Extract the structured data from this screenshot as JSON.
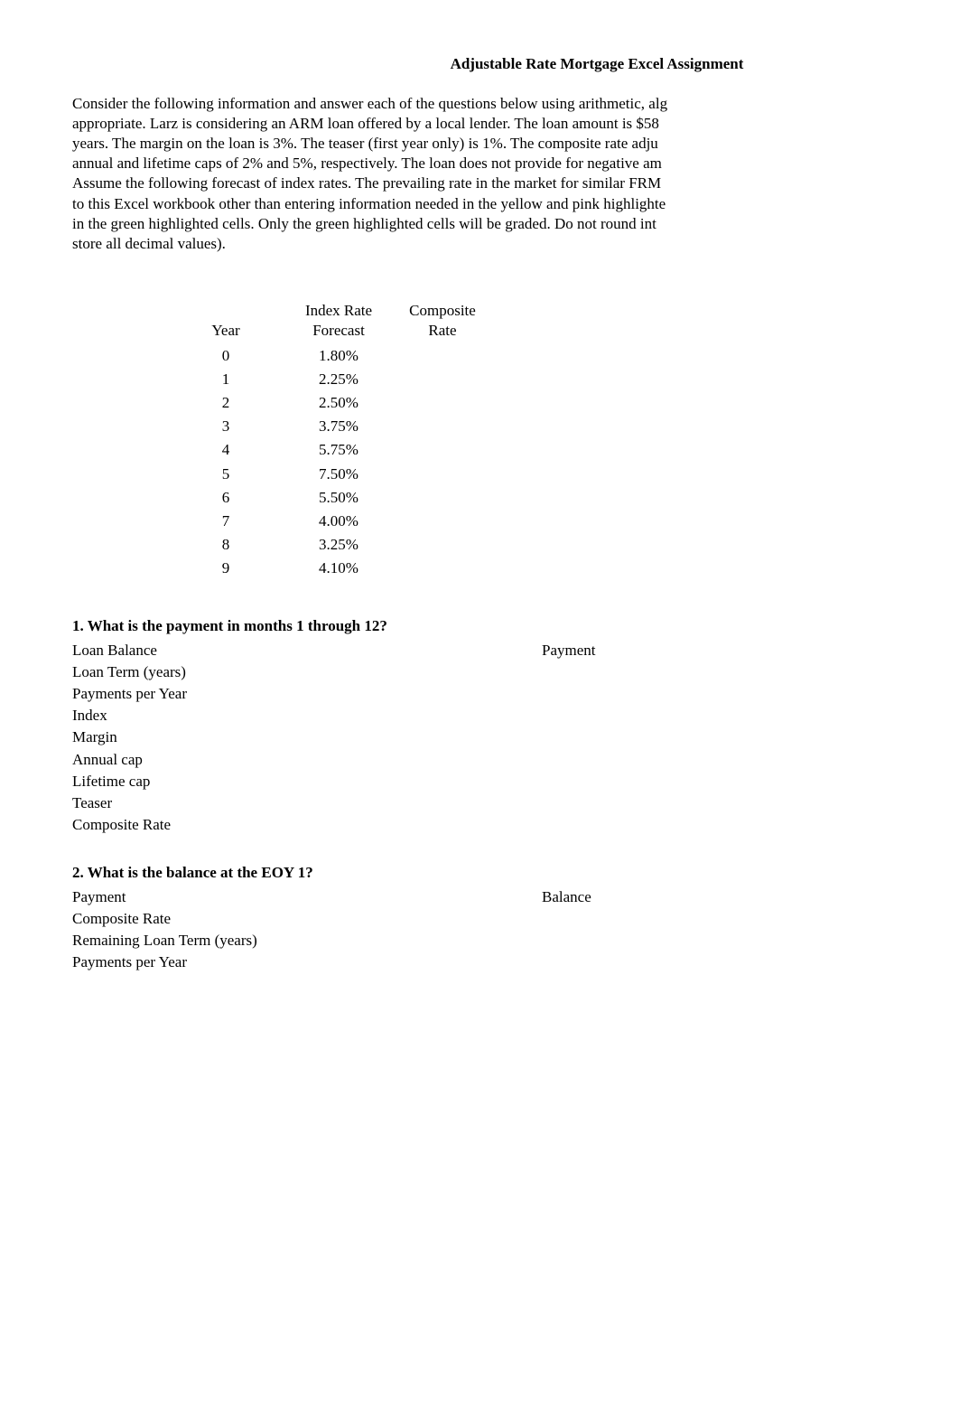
{
  "title": "Adjustable Rate Mortgage Excel Assignment",
  "intro_lines": [
    "Consider the following information and answer each of the questions below using arithmetic, alg",
    "appropriate.  Larz is considering an ARM loan offered by a local lender.  The loan amount is $58",
    "years.  The margin on the loan is 3%.  The teaser (first year only) is 1%.  The composite rate adju",
    "annual and lifetime caps of 2% and 5%, respectively.  The loan does not provide for negative am",
    " Assume the following forecast of index rates.  The prevailing rate in the market for similar FRM",
    "to this Excel workbook other than entering information needed in the yellow and pink highlighte",
    "in the green highlighted cells.  Only the green highlighted cells will be graded.  Do not round int",
    "store all decimal values)."
  ],
  "index_table": {
    "headers": {
      "year": "Year",
      "forecast_l1": "Index Rate",
      "forecast_l2": "Forecast",
      "composite_l1": "Composite",
      "composite_l2": "Rate"
    },
    "rows": [
      {
        "year": "0",
        "forecast": "1.80%",
        "composite": ""
      },
      {
        "year": "1",
        "forecast": "2.25%",
        "composite": ""
      },
      {
        "year": "2",
        "forecast": "2.50%",
        "composite": ""
      },
      {
        "year": "3",
        "forecast": "3.75%",
        "composite": ""
      },
      {
        "year": "4",
        "forecast": "5.75%",
        "composite": ""
      },
      {
        "year": "5",
        "forecast": "7.50%",
        "composite": ""
      },
      {
        "year": "6",
        "forecast": "5.50%",
        "composite": ""
      },
      {
        "year": "7",
        "forecast": "4.00%",
        "composite": ""
      },
      {
        "year": "8",
        "forecast": "3.25%",
        "composite": ""
      },
      {
        "year": "9",
        "forecast": "4.10%",
        "composite": ""
      }
    ]
  },
  "q1": {
    "heading": "1.  What is the payment in months 1 through 12?",
    "result_label": "Payment",
    "fields": [
      "Loan Balance",
      "Loan Term (years)",
      "Payments per Year",
      "Index",
      "Margin",
      "Annual cap",
      "Lifetime cap",
      "Teaser",
      "Composite Rate"
    ]
  },
  "q2": {
    "heading": "2.  What is the balance at the EOY 1?",
    "result_label": "Balance",
    "fields": [
      "Payment",
      "Composite Rate",
      "Remaining Loan Term (years)",
      "Payments per Year"
    ]
  }
}
